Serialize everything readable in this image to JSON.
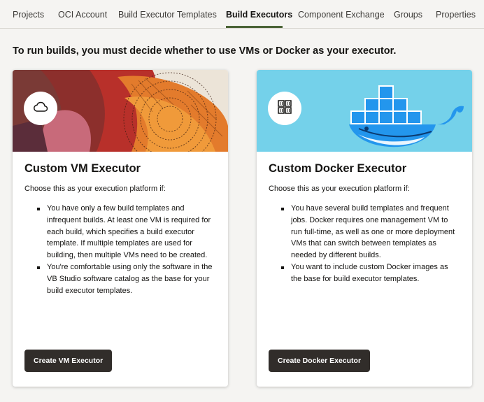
{
  "tabs": [
    {
      "label": "Projects"
    },
    {
      "label": "OCI Account"
    },
    {
      "label": "Build Executor Templates"
    },
    {
      "label": "Build Executors",
      "active": true
    },
    {
      "label": "Component Exchange"
    },
    {
      "label": "Groups"
    },
    {
      "label": "Properties"
    }
  ],
  "headline": "To run builds, you must decide whether to use VMs or Docker as your executor.",
  "vm_card": {
    "icon": "cloud-icon",
    "title": "Custom VM Executor",
    "intro": "Choose this as your execution platform if:",
    "bullets": [
      "You have only a few build templates and infrequent builds. At least one VM is required for each build, which specifies a build executor template. If multiple templates are used for building, then multiple VMs need to be created.",
      "You're comfortable using only the software in the VB Studio software catalog as the base for your build executor templates."
    ],
    "button": "Create VM Executor"
  },
  "docker_card": {
    "icon": "container-grid-icon",
    "title": "Custom Docker Executor",
    "intro": "Choose this as your execution platform if:",
    "bullets": [
      "You have several build templates and frequent jobs. Docker requires one management VM to run full-time, as well as one or more deployment VMs that can switch between templates as needed by different builds.",
      "You want to include custom Docker images as the base for build executor templates."
    ],
    "button": "Create Docker Executor"
  },
  "colors": {
    "accent_underline": "#4a6336",
    "button_bg": "#312d2a",
    "docker_banner": "#74d1ea",
    "docker_blue": "#2396ed"
  }
}
